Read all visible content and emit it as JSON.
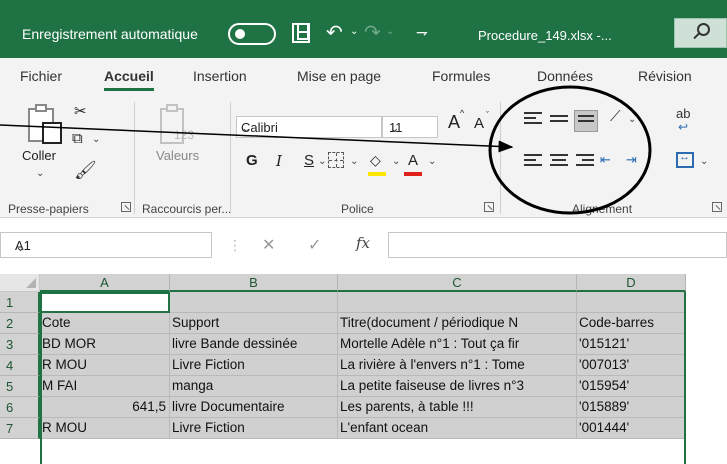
{
  "titlebar": {
    "autosave_label": "Enregistrement automatique",
    "filename": "Procedure_149.xlsx  -...",
    "customize_glyph": "⇁"
  },
  "tabs": [
    {
      "label": "Fichier",
      "active": false
    },
    {
      "label": "Accueil",
      "active": true
    },
    {
      "label": "Insertion",
      "active": false
    },
    {
      "label": "Mise en page",
      "active": false
    },
    {
      "label": "Formules",
      "active": false
    },
    {
      "label": "Données",
      "active": false
    },
    {
      "label": "Révision",
      "active": false
    }
  ],
  "ribbon": {
    "clipboard": {
      "paste_label": "Coller",
      "group_label": "Presse-papiers"
    },
    "shortcuts": {
      "values_label": "Valeurs",
      "values_number": "123",
      "group_label": "Raccourcis per..."
    },
    "font": {
      "name": "Calibri",
      "size": "11",
      "grow_label": "A",
      "shrink_label": "A",
      "bold_label": "G",
      "italic_label": "I",
      "underline_label": "S",
      "color_letter": "A",
      "fill_color": "#ffe600",
      "font_color": "#e0201b",
      "group_label": "Police"
    },
    "alignment": {
      "group_label": "Alignement",
      "wrap_label": "ab"
    }
  },
  "formula_bar": {
    "name_box": "A1",
    "fx_label": "fx",
    "content": ""
  },
  "sheet": {
    "columns": [
      "A",
      "B",
      "C",
      "D"
    ],
    "rows": [
      {
        "num": "1",
        "cells": [
          "",
          "",
          "",
          ""
        ]
      },
      {
        "num": "2",
        "cells": [
          "Cote",
          "Support",
          "Titre(document / périodique N",
          "Code-barres"
        ]
      },
      {
        "num": "3",
        "cells": [
          "BD MOR",
          "livre Bande dessinée",
          "Mortelle Adèle n°1 : Tout ça fir",
          "'015121'"
        ]
      },
      {
        "num": "4",
        "cells": [
          "R MOU",
          "Livre Fiction",
          "La rivière à l'envers n°1 : Tome",
          "'007013'"
        ]
      },
      {
        "num": "5",
        "cells": [
          "M FAI",
          "manga",
          "La petite faiseuse de livres n°3",
          "'015954'"
        ]
      },
      {
        "num": "6",
        "cells": [
          "641,5",
          "livre Documentaire",
          "Les parents, à table !!!",
          "'015889'"
        ]
      },
      {
        "num": "7",
        "cells": [
          "R MOU",
          "Livre Fiction",
          "L'enfant ocean",
          "'001444'"
        ]
      }
    ]
  },
  "colors": {
    "accent": "#1f7244",
    "annotation": "#000000"
  }
}
